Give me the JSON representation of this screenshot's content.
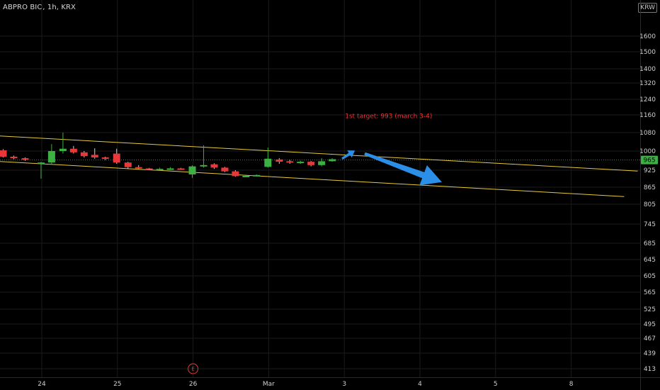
{
  "header": {
    "title": "ABPRO BIO, 1h, KRX",
    "currency": "KRW"
  },
  "colors": {
    "background": "#000000",
    "grid": "#1b1b1b",
    "axis_text": "#cfcfcf",
    "up_candle": "#3cb043",
    "down_candle": "#e8383a",
    "channel_line": "#e6c93a",
    "arrow": "#2b8fe8",
    "annotation": "#e8383a",
    "current_price_line": "#2f9a45"
  },
  "chart_data": {
    "type": "candlestick",
    "y_ticks": [
      1600,
      1500,
      1400,
      1320,
      1240,
      1160,
      1080,
      1000,
      925,
      865,
      805,
      745,
      685,
      645,
      605,
      565,
      525,
      495,
      467,
      439,
      413
    ],
    "x_ticks": [
      {
        "label": "24",
        "x": 24.0
      },
      {
        "label": "25",
        "x": 25.0
      },
      {
        "label": "26",
        "x": 26.0
      },
      {
        "label": "Mar",
        "x": 27.0
      },
      {
        "label": "3",
        "x": 28.0
      },
      {
        "label": "4",
        "x": 29.0
      },
      {
        "label": "5",
        "x": 30.0
      },
      {
        "label": "8",
        "x": 31.0
      }
    ],
    "current_price": {
      "label": "965",
      "value": 965
    },
    "candles": [
      {
        "x": 23.49,
        "o": 1003,
        "h": 1008,
        "l": 975,
        "c": 978
      },
      {
        "x": 23.63,
        "o": 978,
        "h": 982,
        "l": 968,
        "c": 972
      },
      {
        "x": 23.78,
        "o": 972,
        "h": 975,
        "l": 962,
        "c": 966
      },
      {
        "x": 23.99,
        "o": 955,
        "h": 958,
        "l": 895,
        "c": 955
      },
      {
        "x": 24.13,
        "o": 955,
        "h": 1030,
        "l": 950,
        "c": 1000
      },
      {
        "x": 24.28,
        "o": 1000,
        "h": 1080,
        "l": 990,
        "c": 1010
      },
      {
        "x": 24.42,
        "o": 1010,
        "h": 1022,
        "l": 990,
        "c": 995
      },
      {
        "x": 24.56,
        "o": 995,
        "h": 1000,
        "l": 975,
        "c": 980
      },
      {
        "x": 24.7,
        "o": 985,
        "h": 1012,
        "l": 970,
        "c": 975
      },
      {
        "x": 24.84,
        "o": 975,
        "h": 978,
        "l": 965,
        "c": 970
      },
      {
        "x": 24.99,
        "o": 990,
        "h": 1010,
        "l": 950,
        "c": 955
      },
      {
        "x": 25.14,
        "o": 955,
        "h": 958,
        "l": 930,
        "c": 937
      },
      {
        "x": 25.28,
        "o": 937,
        "h": 945,
        "l": 930,
        "c": 933
      },
      {
        "x": 25.42,
        "o": 932,
        "h": 934,
        "l": 925,
        "c": 928
      },
      {
        "x": 25.56,
        "o": 928,
        "h": 935,
        "l": 925,
        "c": 930
      },
      {
        "x": 25.7,
        "o": 930,
        "h": 937,
        "l": 926,
        "c": 932
      },
      {
        "x": 25.84,
        "o": 932,
        "h": 934,
        "l": 927,
        "c": 929
      },
      {
        "x": 25.99,
        "o": 910,
        "h": 944,
        "l": 898,
        "c": 940
      },
      {
        "x": 26.14,
        "o": 940,
        "h": 1025,
        "l": 935,
        "c": 945
      },
      {
        "x": 26.28,
        "o": 948,
        "h": 952,
        "l": 930,
        "c": 935
      },
      {
        "x": 26.42,
        "o": 935,
        "h": 938,
        "l": 918,
        "c": 921
      },
      {
        "x": 26.56,
        "o": 921,
        "h": 925,
        "l": 902,
        "c": 904
      },
      {
        "x": 26.7,
        "o": 903,
        "h": 906,
        "l": 900,
        "c": 905
      },
      {
        "x": 26.84,
        "o": 905,
        "h": 910,
        "l": 903,
        "c": 908
      },
      {
        "x": 26.99,
        "o": 938,
        "h": 1015,
        "l": 935,
        "c": 970
      },
      {
        "x": 27.14,
        "o": 967,
        "h": 972,
        "l": 950,
        "c": 958
      },
      {
        "x": 27.28,
        "o": 960,
        "h": 965,
        "l": 950,
        "c": 955
      },
      {
        "x": 27.42,
        "o": 953,
        "h": 962,
        "l": 950,
        "c": 958
      },
      {
        "x": 27.56,
        "o": 958,
        "h": 961,
        "l": 940,
        "c": 945
      },
      {
        "x": 27.7,
        "o": 945,
        "h": 972,
        "l": 940,
        "c": 960
      },
      {
        "x": 27.84,
        "o": 960,
        "h": 972,
        "l": 958,
        "c": 968
      }
    ],
    "channel": {
      "upper": [
        {
          "x": 22.91,
          "y": 1075
        },
        {
          "x": 31.88,
          "y": 922
        }
      ],
      "lower": [
        {
          "x": 22.91,
          "y": 968
        },
        {
          "x": 31.7,
          "y": 832
        }
      ]
    },
    "arrows": [
      {
        "from": {
          "x": 27.97,
          "y": 970
        },
        "to": {
          "x": 28.14,
          "y": 1002
        },
        "size": "small"
      },
      {
        "from": {
          "x": 28.27,
          "y": 990
        },
        "to": {
          "x": 29.29,
          "y": 883
        },
        "size": "large"
      }
    ],
    "annotation": {
      "text": "1st target: 993 (march 3-4)",
      "x": 28.01,
      "y": 1145
    },
    "earnings_marker": {
      "label": "E",
      "x": 26.0
    }
  }
}
